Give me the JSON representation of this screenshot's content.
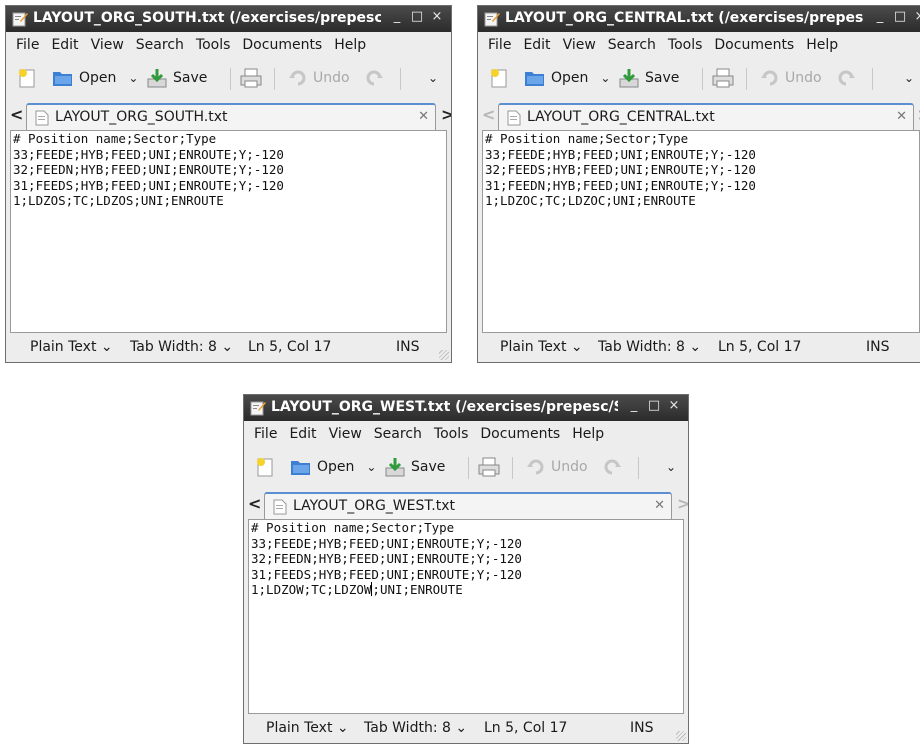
{
  "common": {
    "menus": [
      "File",
      "Edit",
      "View",
      "Search",
      "Tools",
      "Documents",
      "Help"
    ],
    "toolbar": {
      "open_label": "Open",
      "save_label": "Save",
      "undo_label": "Undo"
    },
    "status": {
      "language": "Plain Text",
      "tab_width": "Tab Width:  8",
      "position": "Ln 5, Col 17",
      "mode": "INS"
    },
    "window_controls": [
      "_",
      "□",
      "×"
    ]
  },
  "windows": [
    {
      "title": "LAYOUT_ORG_SOUTH.txt (/exercises/prepesc/",
      "tab_label": "LAYOUT_ORG_SOUTH.txt",
      "lines": [
        "# Position name;Sector;Type",
        "33;FEEDE;HYB;FEED;UNI;ENROUTE;Y;-120",
        "32;FEEDN;HYB;FEED;UNI;ENROUTE;Y;-120",
        "31;FEEDS;HYB;FEED;UNI;ENROUTE;Y;-120",
        "1;LDZOS;TC;LDZOS;UNI;ENROUTE"
      ]
    },
    {
      "title": "LAYOUT_ORG_CENTRAL.txt (/exercises/prepes",
      "tab_label": "LAYOUT_ORG_CENTRAL.txt",
      "lines": [
        "# Position name;Sector;Type",
        "33;FEEDE;HYB;FEED;UNI;ENROUTE;Y;-120",
        "32;FEEDS;HYB;FEED;UNI;ENROUTE;Y;-120",
        "31;FEEDN;HYB;FEED;UNI;ENROUTE;Y;-120",
        "1;LDZOC;TC;LDZOC;UNI;ENROUTE"
      ]
    },
    {
      "title": "LAYOUT_ORG_WEST.txt (/exercises/prepesc/Si",
      "tab_label": "LAYOUT_ORG_WEST.txt",
      "lines": [
        "# Position name;Sector;Type",
        "33;FEEDE;HYB;FEED;UNI;ENROUTE;Y;-120",
        "32;FEEDN;HYB;FEED;UNI;ENROUTE;Y;-120",
        "31;FEEDS;HYB;FEED;UNI;ENROUTE;Y;-120"
      ],
      "cursor_line_before": "1;LDZOW;TC;LDZOW",
      "cursor_line_after": ";UNI;ENROUTE"
    }
  ]
}
